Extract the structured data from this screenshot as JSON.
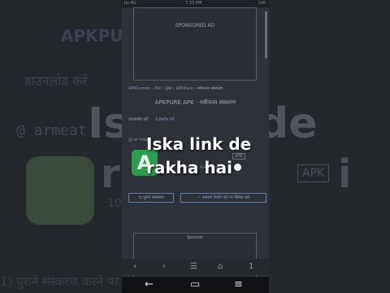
{
  "background": {
    "title": "APKPURE - नवीनतम संस्करण",
    "download": "डाउनलोड करें",
    "user": "@ armeat",
    "big_left": "Is",
    "big_right": "de",
    "big_r": "r",
    "big_i": "i",
    "apk": "APK",
    "ten": "10",
    "bottom": "1) पुराने संस्करण                                  करने पर क्लिक करें"
  },
  "statusbar": {
    "left": "Jio 4G",
    "time": "7:33 PM",
    "right": "100"
  },
  "ad_top": {
    "label": "SPONSORED AD"
  },
  "breadcrumb": {
    "items": [
      "APKCombo",
      "ऐप्स",
      "टूल्स",
      "APKPure",
      "नवीनतम संस्करण"
    ],
    "separator": " › "
  },
  "app_heading": "APKPURE APK - नवीनतम संस्करण",
  "sub_row": {
    "install": "डाउनलोड करें",
    "info": "ℹ इंस्टॉल करें"
  },
  "user_row": "@ ar meat",
  "app": {
    "logo_letter": "A",
    "apk_badge": "APK",
    "meta": "10 MB · Android 4.4+ · mod"
  },
  "buttons": {
    "old_versions": "⇆ पुराने संस्करण",
    "report": "⚐ समस्या रिपोर्ट करें पर क्लिक करें"
  },
  "ad_bottom": {
    "label": "Sponsor"
  },
  "browser_bar": {
    "back": "‹",
    "forward": "›",
    "menu": "☰",
    "home": "⌂",
    "tabs": "1"
  },
  "sysnav": {
    "back": "←",
    "home": "▭",
    "recents": "≡"
  },
  "overlay": {
    "line1": "Iska link de",
    "line2": "rakha hai"
  }
}
